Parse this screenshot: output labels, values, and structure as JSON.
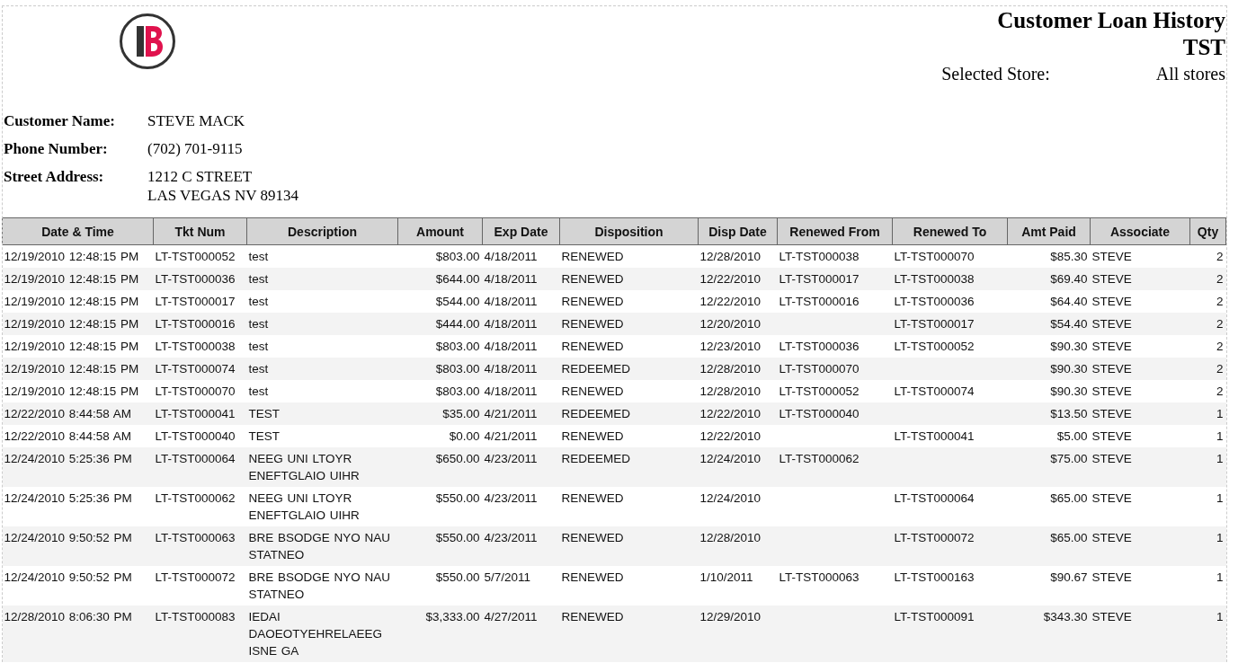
{
  "report": {
    "title": "Customer Loan History",
    "store_code": "TST",
    "selected_store_label": "Selected Store:",
    "selected_store_value": "All stores"
  },
  "customer": [
    {
      "label": "Customer Name:",
      "value": [
        "STEVE MACK"
      ]
    },
    {
      "label": "Phone Number:",
      "value": [
        "(702) 701-9115"
      ]
    },
    {
      "label": "Street Address:",
      "value": [
        "1212 C STREET",
        "LAS VEGAS NV 89134"
      ]
    }
  ],
  "table": {
    "columns": [
      "Date & Time",
      "Tkt Num",
      "Description",
      "Amount",
      "Exp Date",
      "Disposition",
      "Disp Date",
      "Renewed From",
      "Renewed To",
      "Amt Paid",
      "Associate",
      "Qty"
    ],
    "rows": [
      {
        "date_time": "12/19/2010 12:48:15 PM",
        "tkt_num": "LT-TST000052",
        "description": "test",
        "amount": "$803.00",
        "exp_date": "4/18/2011",
        "disposition": "RENEWED",
        "disp_date": "12/28/2010",
        "renewed_from": "LT-TST000038",
        "renewed_to": "LT-TST000070",
        "amt_paid": "$85.30",
        "associate": "STEVE",
        "qty": "2"
      },
      {
        "date_time": "12/19/2010 12:48:15 PM",
        "tkt_num": "LT-TST000036",
        "description": "test",
        "amount": "$644.00",
        "exp_date": "4/18/2011",
        "disposition": "RENEWED",
        "disp_date": "12/22/2010",
        "renewed_from": "LT-TST000017",
        "renewed_to": "LT-TST000038",
        "amt_paid": "$69.40",
        "associate": "STEVE",
        "qty": "2"
      },
      {
        "date_time": "12/19/2010 12:48:15 PM",
        "tkt_num": "LT-TST000017",
        "description": "test",
        "amount": "$544.00",
        "exp_date": "4/18/2011",
        "disposition": "RENEWED",
        "disp_date": "12/22/2010",
        "renewed_from": "LT-TST000016",
        "renewed_to": "LT-TST000036",
        "amt_paid": "$64.40",
        "associate": "STEVE",
        "qty": "2"
      },
      {
        "date_time": "12/19/2010 12:48:15 PM",
        "tkt_num": "LT-TST000016",
        "description": "test",
        "amount": "$444.00",
        "exp_date": "4/18/2011",
        "disposition": "RENEWED",
        "disp_date": "12/20/2010",
        "renewed_to": "LT-TST000017",
        "amt_paid": "$54.40",
        "associate": "STEVE",
        "qty": "2"
      },
      {
        "date_time": "12/19/2010 12:48:15 PM",
        "tkt_num": "LT-TST000038",
        "description": "test",
        "amount": "$803.00",
        "exp_date": "4/18/2011",
        "disposition": "RENEWED",
        "disp_date": "12/23/2010",
        "renewed_from": "LT-TST000036",
        "renewed_to": "LT-TST000052",
        "amt_paid": "$90.30",
        "associate": "STEVE",
        "qty": "2"
      },
      {
        "date_time": "12/19/2010 12:48:15 PM",
        "tkt_num": "LT-TST000074",
        "description": "test",
        "amount": "$803.00",
        "exp_date": "4/18/2011",
        "disposition": "REDEEMED",
        "disp_date": "12/28/2010",
        "renewed_from": "LT-TST000070",
        "amt_paid": "$90.30",
        "associate": "STEVE",
        "qty": "2"
      },
      {
        "date_time": "12/19/2010 12:48:15 PM",
        "tkt_num": "LT-TST000070",
        "description": "test",
        "amount": "$803.00",
        "exp_date": "4/18/2011",
        "disposition": "RENEWED",
        "disp_date": "12/28/2010",
        "renewed_from": "LT-TST000052",
        "renewed_to": "LT-TST000074",
        "amt_paid": "$90.30",
        "associate": "STEVE",
        "qty": "2"
      },
      {
        "date_time": "12/22/2010 8:44:58 AM",
        "tkt_num": "LT-TST000041",
        "description": "TEST",
        "amount": "$35.00",
        "exp_date": "4/21/2011",
        "disposition": "REDEEMED",
        "disp_date": "12/22/2010",
        "renewed_from": "LT-TST000040",
        "amt_paid": "$13.50",
        "associate": "STEVE",
        "qty": "1"
      },
      {
        "date_time": "12/22/2010 8:44:58 AM",
        "tkt_num": "LT-TST000040",
        "description": "TEST",
        "amount": "$0.00",
        "exp_date": "4/21/2011",
        "disposition": "RENEWED",
        "disp_date": "12/22/2010",
        "renewed_to": "LT-TST000041",
        "amt_paid": "$5.00",
        "associate": "STEVE",
        "qty": "1"
      },
      {
        "date_time": "12/24/2010 5:25:36 PM",
        "tkt_num": "LT-TST000064",
        "description": "NEEG UNI LTOYR ENEFTGLAIO UIHR",
        "amount": "$650.00",
        "exp_date": "4/23/2011",
        "disposition": "REDEEMED",
        "disp_date": "12/24/2010",
        "renewed_from": "LT-TST000062",
        "amt_paid": "$75.00",
        "associate": "STEVE",
        "qty": "1"
      },
      {
        "date_time": "12/24/2010 5:25:36 PM",
        "tkt_num": "LT-TST000062",
        "description": "NEEG UNI LTOYR ENEFTGLAIO UIHR",
        "amount": "$550.00",
        "exp_date": "4/23/2011",
        "disposition": "RENEWED",
        "disp_date": "12/24/2010",
        "renewed_to": "LT-TST000064",
        "amt_paid": "$65.00",
        "associate": "STEVE",
        "qty": "1"
      },
      {
        "date_time": "12/24/2010 9:50:52 PM",
        "tkt_num": "LT-TST000063",
        "description": "BRE BSODGE NYO NAU STATNEO",
        "amount": "$550.00",
        "exp_date": "4/23/2011",
        "disposition": "RENEWED",
        "disp_date": "12/28/2010",
        "renewed_to": "LT-TST000072",
        "amt_paid": "$65.00",
        "associate": "STEVE",
        "qty": "1"
      },
      {
        "date_time": "12/24/2010 9:50:52 PM",
        "tkt_num": "LT-TST000072",
        "description": "BRE BSODGE NYO NAU STATNEO",
        "amount": "$550.00",
        "exp_date": "5/7/2011",
        "disposition": "RENEWED",
        "disp_date": "1/10/2011",
        "renewed_from": "LT-TST000063",
        "renewed_to": "LT-TST000163",
        "amt_paid": "$90.67",
        "associate": "STEVE",
        "qty": "1"
      },
      {
        "date_time": "12/28/2010 8:06:30 PM",
        "tkt_num": "LT-TST000083",
        "description": "IEDAI DAOEOTYEHRELAEEG ISNE GA",
        "amount": "$3,333.00",
        "exp_date": "4/27/2011",
        "disposition": "RENEWED",
        "disp_date": "12/29/2010",
        "renewed_to": "LT-TST000091",
        "amt_paid": "$343.30",
        "associate": "STEVE",
        "qty": "1"
      }
    ]
  }
}
